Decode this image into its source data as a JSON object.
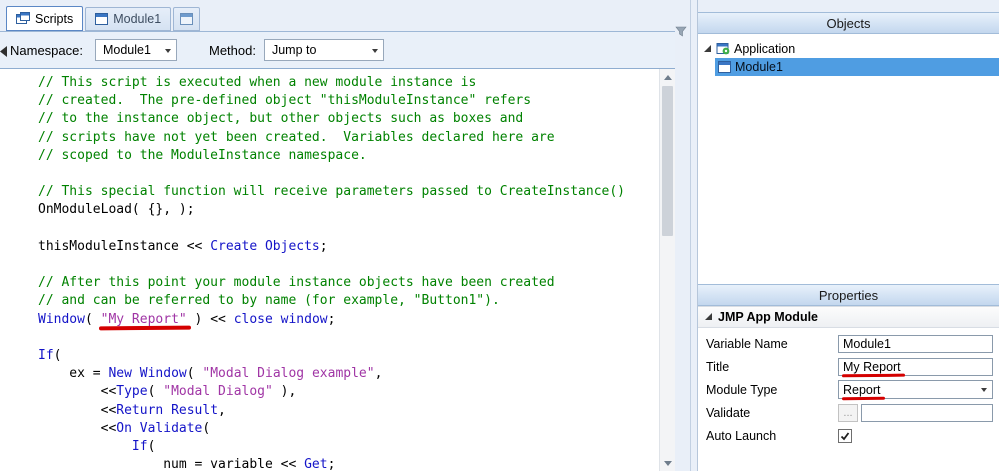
{
  "colors": {
    "comment": "#008200",
    "keyword": "#1414c8",
    "string": "#a035a5",
    "plain": "#000000",
    "annotation": "#d40000",
    "selection": "#4f9de2"
  },
  "tabs": {
    "items": [
      {
        "label": "Scripts",
        "active": true
      },
      {
        "label": "Module1",
        "active": false
      },
      {
        "label": "",
        "active": false
      }
    ]
  },
  "toolbar": {
    "namespace_label": "Namespace:",
    "namespace_value": "Module1",
    "method_label": "Method:",
    "method_value": "Jump to"
  },
  "editor": {
    "lines": [
      [
        {
          "t": "c",
          "x": "// This script is executed when a new module instance is"
        }
      ],
      [
        {
          "t": "c",
          "x": "// created.  The pre-defined object \"thisModuleInstance\" refers"
        }
      ],
      [
        {
          "t": "c",
          "x": "// to the instance object, but other objects such as boxes and"
        }
      ],
      [
        {
          "t": "c",
          "x": "// scripts have not yet been created.  Variables declared here are"
        }
      ],
      [
        {
          "t": "c",
          "x": "// scoped to the ModuleInstance namespace."
        }
      ],
      [],
      [
        {
          "t": "c",
          "x": "// This special function will receive parameters passed to CreateInstance()"
        }
      ],
      [
        {
          "t": "p",
          "x": "OnModuleLoad( {}, );"
        }
      ],
      [],
      [
        {
          "t": "p",
          "x": "thisModuleInstance << "
        },
        {
          "t": "k",
          "x": "Create Objects"
        },
        {
          "t": "p",
          "x": ";"
        }
      ],
      [],
      [
        {
          "t": "c",
          "x": "// After this point your module instance objects have been created"
        }
      ],
      [
        {
          "t": "c",
          "x": "// and can be referred to by name (for example, \"Button1\")."
        }
      ],
      [
        {
          "t": "k",
          "x": "Window"
        },
        {
          "t": "p",
          "x": "( "
        },
        {
          "t": "su",
          "x": "\"My Report\""
        },
        {
          "t": "p",
          "x": " ) << "
        },
        {
          "t": "k",
          "x": "close window"
        },
        {
          "t": "p",
          "x": ";"
        }
      ],
      [],
      [
        {
          "t": "k",
          "x": "If"
        },
        {
          "t": "p",
          "x": "("
        }
      ],
      [
        {
          "t": "p",
          "x": "    ex = "
        },
        {
          "t": "k",
          "x": "New Window"
        },
        {
          "t": "p",
          "x": "( "
        },
        {
          "t": "s",
          "x": "\"Modal Dialog example\""
        },
        {
          "t": "p",
          "x": ","
        }
      ],
      [
        {
          "t": "p",
          "x": "        <<"
        },
        {
          "t": "k",
          "x": "Type"
        },
        {
          "t": "p",
          "x": "( "
        },
        {
          "t": "s",
          "x": "\"Modal Dialog\""
        },
        {
          "t": "p",
          "x": " ),"
        }
      ],
      [
        {
          "t": "p",
          "x": "        <<"
        },
        {
          "t": "k",
          "x": "Return Result"
        },
        {
          "t": "p",
          "x": ","
        }
      ],
      [
        {
          "t": "p",
          "x": "        <<"
        },
        {
          "t": "k",
          "x": "On Validate"
        },
        {
          "t": "p",
          "x": "("
        }
      ],
      [
        {
          "t": "p",
          "x": "            "
        },
        {
          "t": "k",
          "x": "If"
        },
        {
          "t": "p",
          "x": "("
        }
      ],
      [
        {
          "t": "p",
          "x": "                num = variable << "
        },
        {
          "t": "k",
          "x": "Get"
        },
        {
          "t": "p",
          "x": ";"
        }
      ]
    ]
  },
  "objects": {
    "header": "Objects",
    "tree": [
      {
        "label": "Application",
        "selected": false
      },
      {
        "label": "Module1",
        "selected": true
      }
    ]
  },
  "properties": {
    "header": "Properties",
    "section_title": "JMP App Module",
    "rows": [
      {
        "label": "Variable Name",
        "type": "text",
        "value": "Module1"
      },
      {
        "label": "Title",
        "type": "text",
        "value": "My Report",
        "annotated": true
      },
      {
        "label": "Module Type",
        "type": "select",
        "value": "Report",
        "annotated": true
      },
      {
        "label": "Validate",
        "type": "ellipsis",
        "value": "",
        "button": "..."
      },
      {
        "label": "Auto Launch",
        "type": "checkbox",
        "checked": true
      }
    ]
  }
}
